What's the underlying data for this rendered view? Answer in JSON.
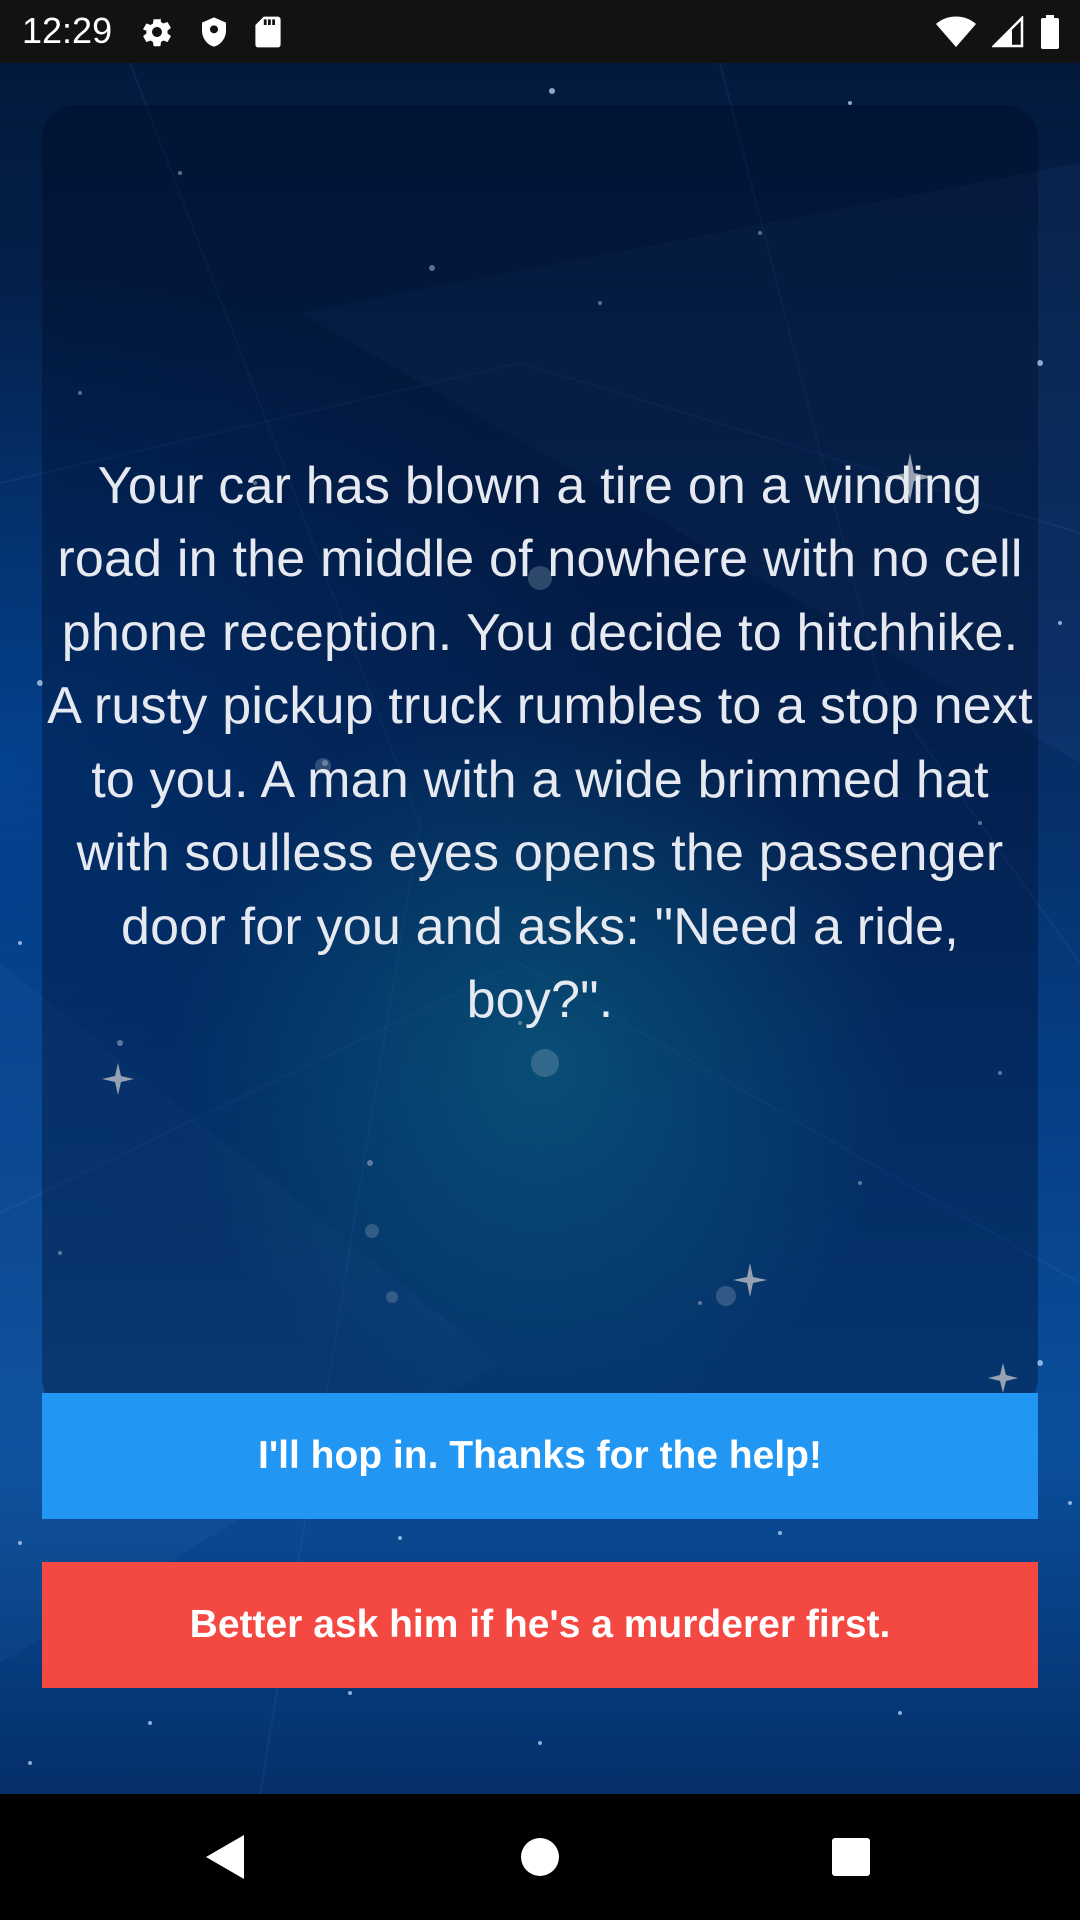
{
  "status_bar": {
    "time": "12:29",
    "left_icons": [
      "settings-icon",
      "shield-icon",
      "sd-card-icon"
    ],
    "right_icons": [
      "wifi-icon",
      "cell-signal-icon",
      "battery-icon"
    ]
  },
  "story": {
    "text": "Your car has blown a tire on a winding road in the middle of nowhere with no cell phone reception. You decide to hitchhike. A rusty pickup truck rumbles to a stop next to you. A man with a wide brimmed hat with soulless eyes opens the passenger door for you and asks: \"Need a ride, boy?\"."
  },
  "choices": [
    {
      "label": "I'll hop in. Thanks for the help!",
      "color": "#2196f3"
    },
    {
      "label": "Better ask him if he's a murderer first.",
      "color": "#f44842"
    }
  ],
  "nav_bar": {
    "buttons": [
      "back-icon",
      "home-icon",
      "recents-icon"
    ]
  }
}
